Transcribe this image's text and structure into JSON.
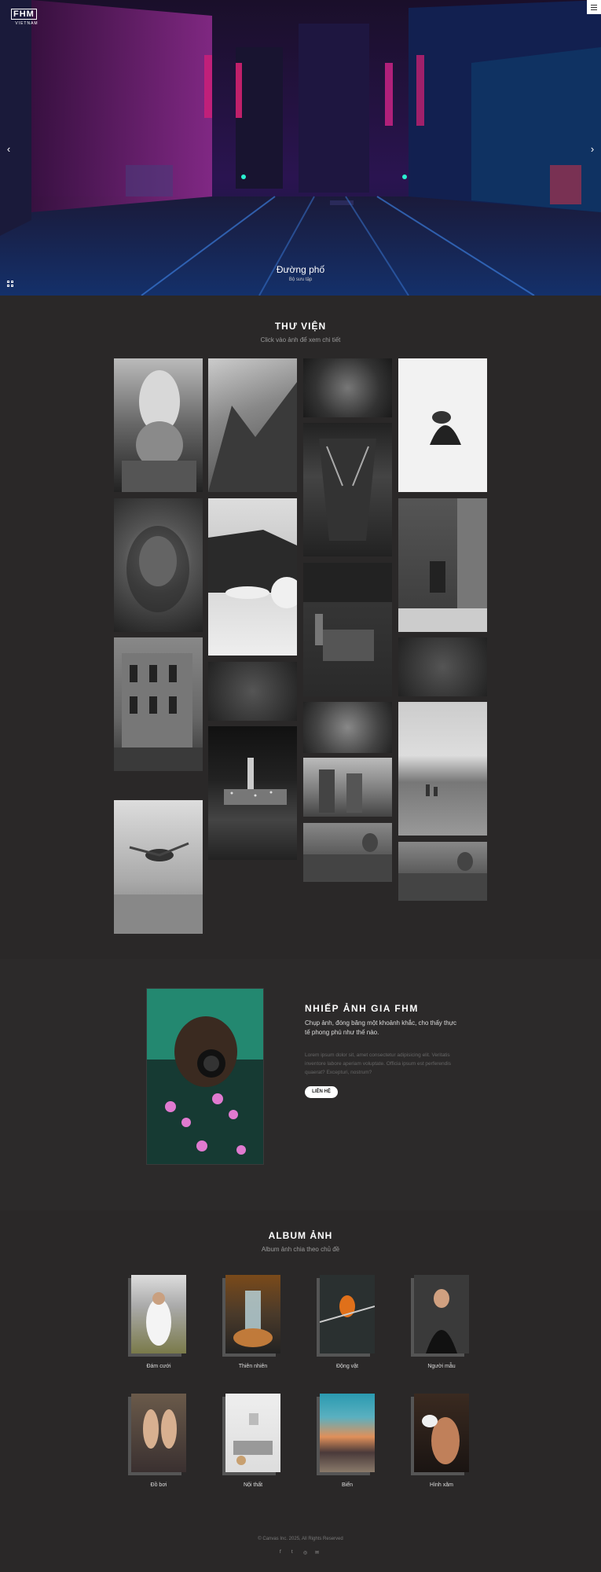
{
  "brand": {
    "logo_text": "FHM",
    "logo_sub": "VIETNAM"
  },
  "hero": {
    "title": "Đường phố",
    "subtitle": "Bộ sưu tập",
    "prev_arrow": "‹",
    "next_arrow": "›"
  },
  "gallery": {
    "title": "THƯ VIỆN",
    "subtitle": "Click vào ảnh để xem chi tiết"
  },
  "photographer": {
    "title": "NHIẾP ẢNH GIA FHM",
    "text": "Chụp ảnh, đóng băng một khoảnh khắc, cho thấy thực tế phong phú như thế nào.",
    "lorem": "Lorem ipsum dolor sit, amet consectetur adipisicing elit. Veritatis inventore labore aperiam voluptate. Officia ipsum est perferendis quaerat? Excepturi, nostrum?",
    "button": "LIÊN HỆ"
  },
  "albums": {
    "title": "ALBUM ẢNH",
    "subtitle": "Album ảnh chia theo chủ đề",
    "items": [
      {
        "label": "Đám cưới"
      },
      {
        "label": "Thiên nhiên"
      },
      {
        "label": "Động vật"
      },
      {
        "label": "Người mẫu"
      },
      {
        "label": "Đồ bơi"
      },
      {
        "label": "Nội thất"
      },
      {
        "label": "Biển"
      },
      {
        "label": "Hình xăm"
      }
    ]
  },
  "footer": {
    "copyright": "© Canvas Inc. 2025, All Rights Reserved",
    "social": [
      "f",
      "t",
      "◎",
      "✉"
    ]
  }
}
